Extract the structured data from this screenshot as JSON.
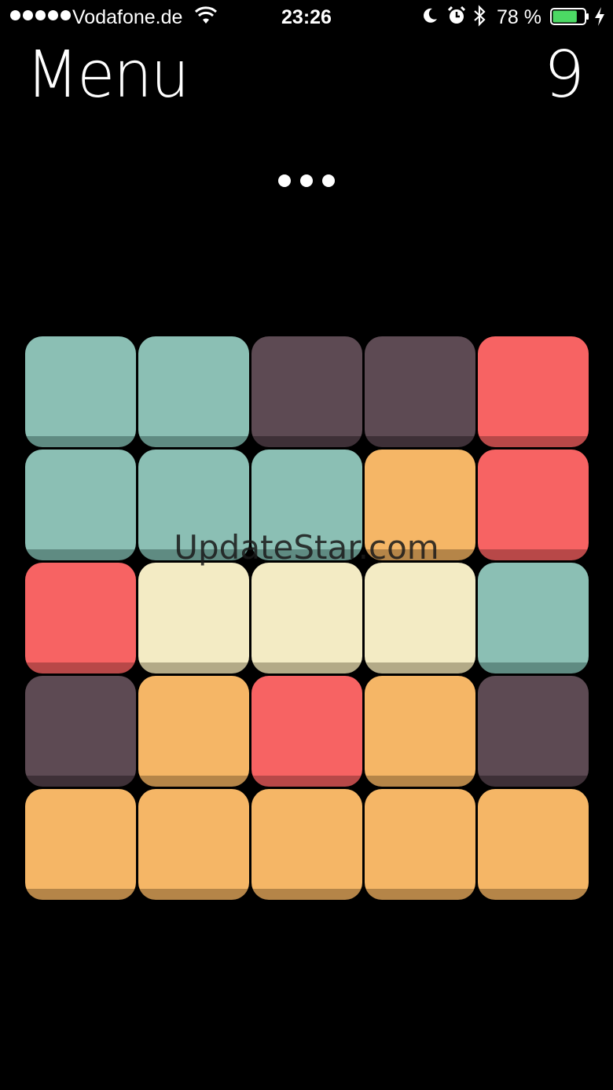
{
  "status_bar": {
    "carrier": "Vodafone.de",
    "time": "23:26",
    "battery_percent": "78 %",
    "battery_level": 0.78
  },
  "header": {
    "title": "Menu",
    "moves": "9"
  },
  "page_indicator": {
    "dots": 3
  },
  "colors": {
    "teal": "#8bbfb4",
    "teal_shadow": "#5f8b82",
    "plum": "#5d4a53",
    "plum_shadow": "#3e3037",
    "coral": "#f76363",
    "coral_shadow": "#b84848",
    "orange": "#f5b666",
    "orange_shadow": "#b58548",
    "cream": "#f3ebc4",
    "cream_shadow": "#b3aa87",
    "battery_green": "#4cd964"
  },
  "board": {
    "rows": [
      [
        "teal",
        "teal",
        "plum",
        "plum",
        "coral"
      ],
      [
        "teal",
        "teal",
        "teal",
        "orange",
        "coral"
      ],
      [
        "coral",
        "cream",
        "cream",
        "cream",
        "teal"
      ],
      [
        "plum",
        "orange",
        "coral",
        "orange",
        "plum"
      ],
      [
        "orange",
        "orange",
        "orange",
        "orange",
        "orange"
      ]
    ]
  },
  "watermark": "UpdateStar.com"
}
